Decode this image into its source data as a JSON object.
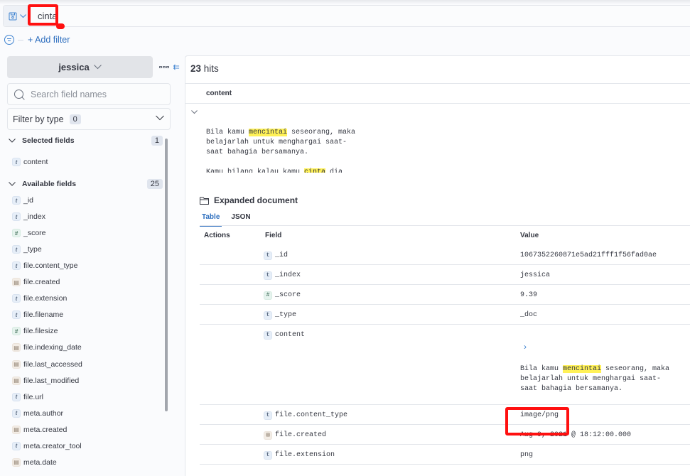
{
  "query_bar": {
    "query": "cinta",
    "menu_icon": "save-icon"
  },
  "filter_bar": {
    "add_filter_label": "+ Add filter"
  },
  "sidebar": {
    "index_pattern": "jessica",
    "search_placeholder": "Search field names",
    "filter_by_type_label": "Filter by type",
    "filter_by_type_count": "0",
    "selected_fields": {
      "title": "Selected fields",
      "count": "1",
      "items": [
        {
          "type": "t",
          "name": "content"
        }
      ]
    },
    "available_fields": {
      "title": "Available fields",
      "count": "25",
      "items": [
        {
          "type": "t",
          "name": "_id"
        },
        {
          "type": "t",
          "name": "_index"
        },
        {
          "type": "#",
          "name": "_score"
        },
        {
          "type": "t",
          "name": "_type"
        },
        {
          "type": "t",
          "name": "file.content_type"
        },
        {
          "type": "date",
          "name": "file.created"
        },
        {
          "type": "t",
          "name": "file.extension"
        },
        {
          "type": "t",
          "name": "file.filename"
        },
        {
          "type": "#",
          "name": "file.filesize"
        },
        {
          "type": "date",
          "name": "file.indexing_date"
        },
        {
          "type": "date",
          "name": "file.last_accessed"
        },
        {
          "type": "date",
          "name": "file.last_modified"
        },
        {
          "type": "t",
          "name": "file.url"
        },
        {
          "type": "t",
          "name": "meta.author"
        },
        {
          "type": "date",
          "name": "meta.created"
        },
        {
          "type": "t",
          "name": "meta.creator_tool"
        },
        {
          "type": "date",
          "name": "meta.date"
        }
      ]
    }
  },
  "main": {
    "hits_count": "23",
    "hits_label": "hits",
    "column_header": "content",
    "snippet": {
      "line1_pre": "Bila kamu ",
      "line1_mark": "mencintai",
      "line1_post": " seseorang, maka",
      "line2": "belajarlah untuk menghargai saat-",
      "line3": "saat bahagia bersamanya.",
      "line5_pre": "Kamu bilang kalau kamu ",
      "line5_mark": "cinta",
      "line5_post": " dia"
    },
    "expanded": {
      "title": "Expanded document",
      "tabs": [
        {
          "label": "Table",
          "active": true
        },
        {
          "label": "JSON",
          "active": false
        }
      ],
      "headers": {
        "actions": "Actions",
        "field": "Field",
        "value": "Value"
      },
      "rows": [
        {
          "type": "t",
          "field": "_id",
          "value": "1067352260871e5ad21fff1f56fad0ae"
        },
        {
          "type": "t",
          "field": "_index",
          "value": "jessica"
        },
        {
          "type": "#",
          "field": "_score",
          "value": "9.39"
        },
        {
          "type": "t",
          "field": "_type",
          "value": "_doc"
        },
        {
          "type": "t",
          "field": "content",
          "value": ""
        },
        {
          "type": "t",
          "field": "file.content_type",
          "value": "image/png"
        },
        {
          "type": "date",
          "field": "file.created",
          "value": "Aug 9, 2021 @ 18:12:00.000"
        },
        {
          "type": "t",
          "field": "file.extension",
          "value": "png"
        }
      ]
    }
  },
  "annotations": {
    "highlight_color": "#ff1010",
    "mark_color": "#fff157",
    "accent_color": "#2e6fbf"
  }
}
